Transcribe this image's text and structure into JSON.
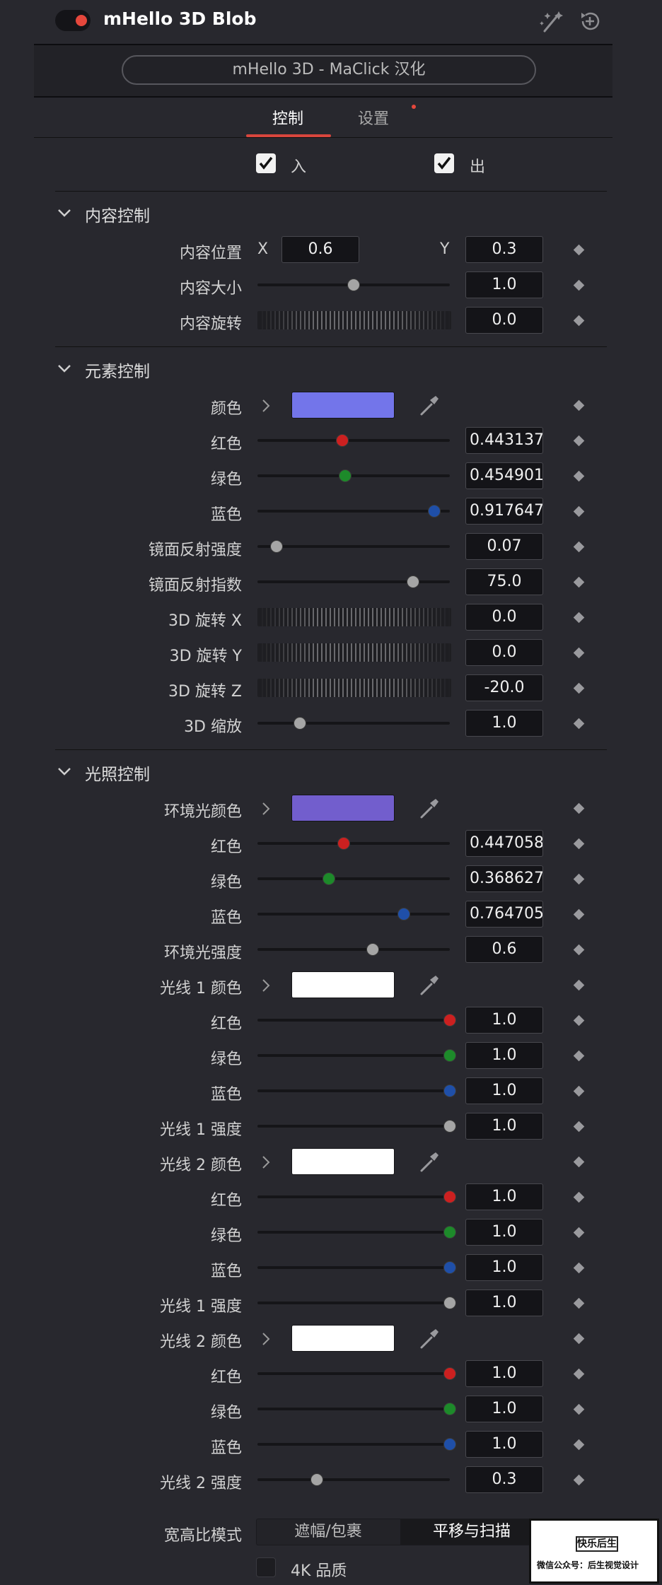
{
  "header": {
    "title": "mHello 3D Blob",
    "enabled": true,
    "icons": [
      "magic-wand-icon",
      "reset-icon"
    ],
    "preset_label": "mHello 3D - MaClick 汉化"
  },
  "tabs": [
    {
      "label": "控制",
      "active": true
    },
    {
      "label": "设置",
      "active": false,
      "notice": true
    }
  ],
  "io": [
    {
      "label": "入",
      "checked": true
    },
    {
      "label": "出",
      "checked": true
    }
  ],
  "colors": {
    "accent": "#d8463d",
    "red_knob": "#cc2020",
    "green_knob": "#1d8a2a",
    "blue_knob": "#1f4fa8",
    "gray_knob": "#a5a5a5"
  },
  "sections": {
    "content": {
      "title": "内容控制",
      "position": {
        "label": "内容位置",
        "x_label": "X",
        "x": "0.6",
        "y_label": "Y",
        "y": "0.3"
      },
      "size": {
        "label": "内容大小",
        "value": "1.0",
        "level": 0.5
      },
      "rotation": {
        "label": "内容旋转",
        "value": "0.0"
      }
    },
    "element": {
      "title": "元素控制",
      "color": {
        "label": "颜色",
        "swatch": "#7375ea"
      },
      "red": {
        "label": "红色",
        "value": "0.443137",
        "level": 0.443
      },
      "green": {
        "label": "绿色",
        "value": "0.454901",
        "level": 0.455
      },
      "blue": {
        "label": "蓝色",
        "value": "0.917647",
        "level": 0.918
      },
      "spec_strength": {
        "label": "镜面反射强度",
        "value": "0.07",
        "level": 0.1
      },
      "spec_exp": {
        "label": "镜面反射指数",
        "value": "75.0",
        "level": 0.81
      },
      "rot_x": {
        "label": "3D 旋转 X",
        "value": "0.0"
      },
      "rot_y": {
        "label": "3D 旋转 Y",
        "value": "0.0"
      },
      "rot_z": {
        "label": "3D 旋转 Z",
        "value": "-20.0"
      },
      "scale": {
        "label": "3D 缩放",
        "value": "1.0",
        "level": 0.22
      }
    },
    "lighting": {
      "title": "光照控制",
      "ambient_color": {
        "label": "环境光颜色",
        "swatch": "#725ecd"
      },
      "amb_red": {
        "label": "红色",
        "value": "0.447058",
        "level": 0.45
      },
      "amb_green": {
        "label": "绿色",
        "value": "0.368627",
        "level": 0.37
      },
      "amb_blue": {
        "label": "蓝色",
        "value": "0.764705",
        "level": 0.76
      },
      "amb_strength": {
        "label": "环境光强度",
        "value": "0.6",
        "level": 0.6
      },
      "light1_color": {
        "label": "光线 1 颜色",
        "swatch": "#ffffff"
      },
      "l1_red": {
        "label": "红色",
        "value": "1.0",
        "level": 1.0
      },
      "l1_green": {
        "label": "绿色",
        "value": "1.0",
        "level": 1.0
      },
      "l1_blue": {
        "label": "蓝色",
        "value": "1.0",
        "level": 1.0
      },
      "l1_strength": {
        "label": "光线 1 强度",
        "value": "1.0",
        "level": 1.0
      },
      "light2_color": {
        "label": "光线 2 颜色",
        "swatch": "#ffffff"
      },
      "l2_red": {
        "label": "红色",
        "value": "1.0",
        "level": 1.0
      },
      "l2_green": {
        "label": "绿色",
        "value": "1.0",
        "level": 1.0
      },
      "l2_blue": {
        "label": "蓝色",
        "value": "1.0",
        "level": 1.0
      },
      "l2_strength_dup": {
        "label": "光线 1 强度",
        "value": "1.0",
        "level": 1.0
      },
      "light3_color": {
        "label": "光线 2 颜色",
        "swatch": "#ffffff"
      },
      "l3_red": {
        "label": "红色",
        "value": "1.0",
        "level": 1.0
      },
      "l3_green": {
        "label": "绿色",
        "value": "1.0",
        "level": 1.0
      },
      "l3_blue": {
        "label": "蓝色",
        "value": "1.0",
        "level": 1.0
      },
      "l2_strength": {
        "label": "光线 2 强度",
        "value": "0.3",
        "level": 0.31
      }
    }
  },
  "aspect": {
    "label": "宽高比模式",
    "options": [
      "遮幅/包裹",
      "平移与扫描"
    ],
    "selected": "平移与扫描"
  },
  "quality": {
    "label": "4K 品质",
    "checked": false
  },
  "watermark": {
    "line1": "快乐后生",
    "line2": "微信公众号：后生视觉设计"
  }
}
